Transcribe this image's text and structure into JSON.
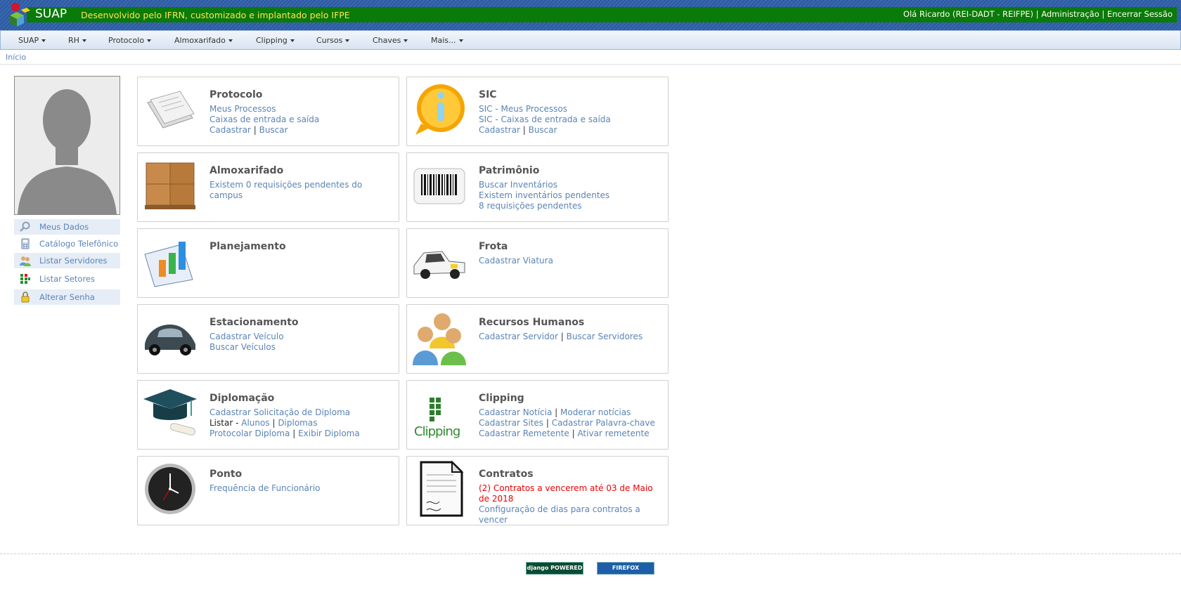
{
  "header": {
    "app_name": "SUAP",
    "tagline": "Desenvolvido pelo IFRN, customizado e implantado pelo IFPE",
    "greeting": "Olá Ricardo (REI-DADT - REIFPE)",
    "admin": "Administração",
    "logout": "Encerrar Sessão",
    "separator": "|"
  },
  "menu": [
    "SUAP",
    "RH",
    "Protocolo",
    "Almoxarifado",
    "Clipping",
    "Cursos",
    "Chaves",
    "Mais..."
  ],
  "breadcrumb": "Início",
  "sidebar": [
    {
      "label": "Meus Dados",
      "icon": "magnifier-icon"
    },
    {
      "label": "Catálogo Telefônico",
      "icon": "phone-icon"
    },
    {
      "label": "Listar Servidores",
      "icon": "users-icon"
    },
    {
      "label": "Listar Setores",
      "icon": "sectors-icon"
    },
    {
      "label": "Alterar Senha",
      "icon": "lock-icon"
    }
  ],
  "cards": {
    "protocolo": {
      "title": "Protocolo",
      "l1": "Meus Processos",
      "l2": "Caixas de entrada e saída",
      "l3a": "Cadastrar",
      "l3b": "Buscar"
    },
    "sic": {
      "title": "SIC",
      "l1": "SIC - Meus Processos",
      "l2": "SIC - Caixas de entrada e saída",
      "l3a": "Cadastrar",
      "l3b": "Buscar"
    },
    "almoxarifado": {
      "title": "Almoxarifado",
      "l1": "Existem 0 requisições pendentes do campus"
    },
    "patrimonio": {
      "title": "Patrimônio",
      "l1": "Buscar Inventários",
      "l2": "Existem inventários pendentes",
      "l3": "8 requisições pendentes"
    },
    "planejamento": {
      "title": "Planejamento"
    },
    "frota": {
      "title": "Frota",
      "l1": "Cadastrar Viatura"
    },
    "estacionamento": {
      "title": "Estacionamento",
      "l1": "Cadastrar Veículo",
      "l2": "Buscar Veículos"
    },
    "rh": {
      "title": "Recursos Humanos",
      "l1a": "Cadastrar Servidor",
      "l1b": "Buscar Servidores"
    },
    "diplomacao": {
      "title": "Diplomação",
      "l1": "Cadastrar Solicitação de Diploma",
      "l2_prefix": "Listar -",
      "l2a": "Alunos",
      "l2b": "Diplomas",
      "l3a": "Protocolar Diploma",
      "l3b": "Exibir Diploma"
    },
    "clipping": {
      "title": "Clipping",
      "icon_text": "Clipping",
      "l1a": "Cadastrar Notícia",
      "l1b": "Moderar notícias",
      "l2a": "Cadastrar Sites",
      "l2b": "Cadastrar Palavra-chave",
      "l3a": "Cadastrar Remetente",
      "l3b": "Ativar remetente"
    },
    "ponto": {
      "title": "Ponto",
      "l1": "Frequência de Funcionário"
    },
    "contratos": {
      "title": "Contratos",
      "alert": "(2) Contratos a vencerem até 03 de Maio de 2018",
      "l2": "Configuração de dias para contratos a vencer"
    }
  },
  "footer": {
    "django": "django POWERED",
    "firefox": "FIREFOX"
  },
  "colors": {
    "header_green": "#0a7a0a",
    "link_blue": "#5a84b6",
    "tagline_yellow": "#ffe84d",
    "alert_red": "#e00000"
  }
}
